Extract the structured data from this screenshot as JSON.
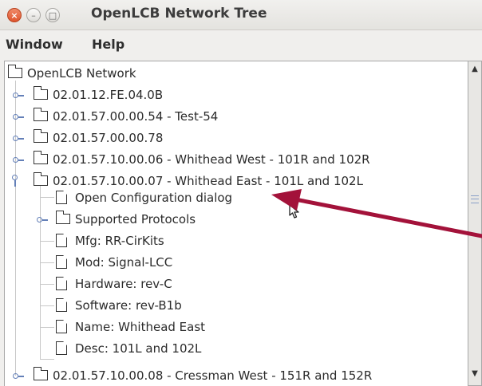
{
  "window": {
    "title": "OpenLCB Network Tree",
    "close_glyph": "×",
    "min_glyph": "–",
    "max_glyph": "□"
  },
  "menubar": {
    "items": [
      "Window",
      "Help"
    ]
  },
  "tree": {
    "root": "OpenLCB Network",
    "nodes": [
      "02.01.12.FE.04.0B",
      "02.01.57.00.00.54 - Test-54",
      "02.01.57.00.00.78",
      "02.01.57.10.00.06 - Whithead West - 101R and 102R",
      "02.01.57.10.00.07 - Whithead East - 101L and 102L"
    ],
    "children": [
      "Open Configuration dialog",
      "Supported Protocols",
      "Mfg: RR-CirKits",
      "Mod: Signal-LCC",
      "Hardware: rev-C",
      "Software: rev-B1b",
      "Name: Whithead East",
      "Desc: 101L and 102L"
    ],
    "last_node": "02.01.57.10.00.08 - Cressman West - 151R and 152R"
  },
  "colors": {
    "annotation_arrow": "#a3123a",
    "tree_handle": "#6480b8"
  }
}
